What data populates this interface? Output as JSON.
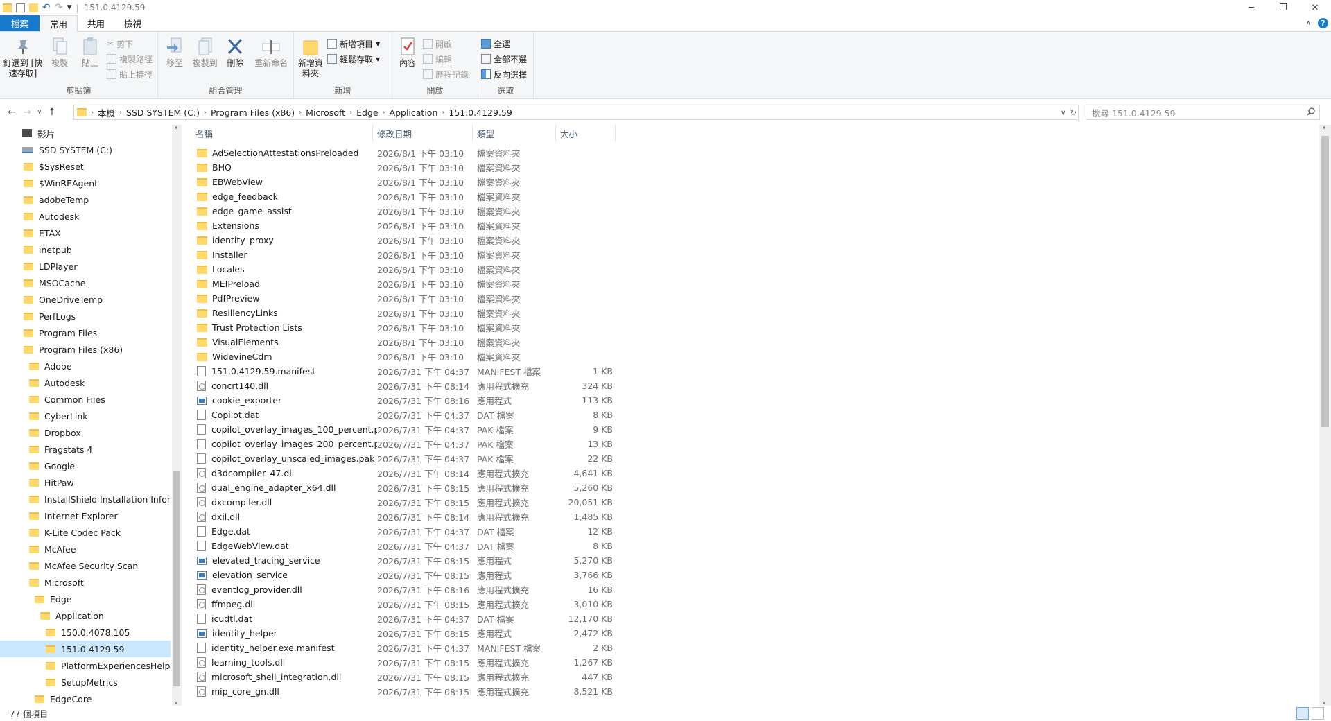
{
  "window": {
    "title": "151.0.4129.59"
  },
  "tabs": [
    {
      "label": "檔案"
    },
    {
      "label": "常用"
    },
    {
      "label": "共用"
    },
    {
      "label": "檢視"
    }
  ],
  "ribbon": {
    "clipboard": {
      "pin": "釘選到 [快速存取]",
      "copy": "複製",
      "paste": "貼上",
      "cut": "剪下",
      "copy_path": "複製路徑",
      "paste_shortcut": "貼上捷徑",
      "label": "剪貼簿"
    },
    "organize": {
      "move_to": "移至",
      "copy_to": "複製到",
      "delete": "刪除",
      "rename": "重新命名",
      "label": "組合管理"
    },
    "new": {
      "new_folder": "新增資料夾",
      "new_item": "新增項目",
      "easy_access": "輕鬆存取",
      "label": "新增"
    },
    "open": {
      "properties": "內容",
      "open": "開啟",
      "edit": "編輯",
      "history": "歷程記錄",
      "label": "開啟"
    },
    "select": {
      "select_all": "全選",
      "select_none": "全部不選",
      "invert": "反向選擇",
      "label": "選取"
    }
  },
  "address": {
    "crumbs": [
      "本機",
      "SSD SYSTEM (C:)",
      "Program Files (x86)",
      "Microsoft",
      "Edge",
      "Application",
      "151.0.4129.59"
    ],
    "search_placeholder": "搜尋 151.0.4129.59"
  },
  "nav": [
    {
      "label": "影片",
      "indent": 0
    },
    {
      "label": "SSD SYSTEM (C:)",
      "indent": 0
    },
    {
      "label": "$SysReset",
      "indent": 1
    },
    {
      "label": "$WinREAgent",
      "indent": 1
    },
    {
      "label": "adobeTemp",
      "indent": 1
    },
    {
      "label": "Autodesk",
      "indent": 1
    },
    {
      "label": "ETAX",
      "indent": 1
    },
    {
      "label": "inetpub",
      "indent": 1
    },
    {
      "label": "LDPlayer",
      "indent": 1
    },
    {
      "label": "MSOCache",
      "indent": 1
    },
    {
      "label": "OneDriveTemp",
      "indent": 1
    },
    {
      "label": "PerfLogs",
      "indent": 1
    },
    {
      "label": "Program Files",
      "indent": 1
    },
    {
      "label": "Program Files (x86)",
      "indent": 1
    },
    {
      "label": "Adobe",
      "indent": 2
    },
    {
      "label": "Autodesk",
      "indent": 2
    },
    {
      "label": "Common Files",
      "indent": 2
    },
    {
      "label": "CyberLink",
      "indent": 2
    },
    {
      "label": "Dropbox",
      "indent": 2
    },
    {
      "label": "Fragstats 4",
      "indent": 2
    },
    {
      "label": "Google",
      "indent": 2
    },
    {
      "label": "HitPaw",
      "indent": 2
    },
    {
      "label": "InstallShield Installation Informa",
      "indent": 2
    },
    {
      "label": "Internet Explorer",
      "indent": 2
    },
    {
      "label": "K-Lite Codec Pack",
      "indent": 2
    },
    {
      "label": "McAfee",
      "indent": 2
    },
    {
      "label": "McAfee Security Scan",
      "indent": 2
    },
    {
      "label": "Microsoft",
      "indent": 2
    },
    {
      "label": "Edge",
      "indent": 3
    },
    {
      "label": "Application",
      "indent": 4
    },
    {
      "label": "150.0.4078.105",
      "indent": 5
    },
    {
      "label": "151.0.4129.59",
      "indent": 5,
      "selected": true
    },
    {
      "label": "PlatformExperiencesHelper",
      "indent": 5
    },
    {
      "label": "SetupMetrics",
      "indent": 5
    },
    {
      "label": "EdgeCore",
      "indent": 3
    }
  ],
  "columns": {
    "name": "名稱",
    "date": "修改日期",
    "type": "類型",
    "size": "大小"
  },
  "files": [
    {
      "name": "AdSelectionAttestationsPreloaded",
      "date": "2026/8/1 下午 03:10",
      "type": "檔案資料夾",
      "size": "",
      "icon": "folder"
    },
    {
      "name": "BHO",
      "date": "2026/8/1 下午 03:10",
      "type": "檔案資料夾",
      "size": "",
      "icon": "folder"
    },
    {
      "name": "EBWebView",
      "date": "2026/8/1 下午 03:10",
      "type": "檔案資料夾",
      "size": "",
      "icon": "folder"
    },
    {
      "name": "edge_feedback",
      "date": "2026/8/1 下午 03:10",
      "type": "檔案資料夾",
      "size": "",
      "icon": "folder"
    },
    {
      "name": "edge_game_assist",
      "date": "2026/8/1 下午 03:10",
      "type": "檔案資料夾",
      "size": "",
      "icon": "folder"
    },
    {
      "name": "Extensions",
      "date": "2026/8/1 下午 03:10",
      "type": "檔案資料夾",
      "size": "",
      "icon": "folder"
    },
    {
      "name": "identity_proxy",
      "date": "2026/8/1 下午 03:10",
      "type": "檔案資料夾",
      "size": "",
      "icon": "folder"
    },
    {
      "name": "Installer",
      "date": "2026/8/1 下午 03:10",
      "type": "檔案資料夾",
      "size": "",
      "icon": "folder"
    },
    {
      "name": "Locales",
      "date": "2026/8/1 下午 03:10",
      "type": "檔案資料夾",
      "size": "",
      "icon": "folder"
    },
    {
      "name": "MEIPreload",
      "date": "2026/8/1 下午 03:10",
      "type": "檔案資料夾",
      "size": "",
      "icon": "folder"
    },
    {
      "name": "PdfPreview",
      "date": "2026/8/1 下午 03:10",
      "type": "檔案資料夾",
      "size": "",
      "icon": "folder"
    },
    {
      "name": "ResiliencyLinks",
      "date": "2026/8/1 下午 03:10",
      "type": "檔案資料夾",
      "size": "",
      "icon": "folder"
    },
    {
      "name": "Trust Protection Lists",
      "date": "2026/8/1 下午 03:10",
      "type": "檔案資料夾",
      "size": "",
      "icon": "folder"
    },
    {
      "name": "VisualElements",
      "date": "2026/8/1 下午 03:10",
      "type": "檔案資料夾",
      "size": "",
      "icon": "folder"
    },
    {
      "name": "WidevineCdm",
      "date": "2026/8/1 下午 03:10",
      "type": "檔案資料夾",
      "size": "",
      "icon": "folder"
    },
    {
      "name": "151.0.4129.59.manifest",
      "date": "2026/7/31 下午 04:37",
      "type": "MANIFEST 檔案",
      "size": "1 KB",
      "icon": "doc"
    },
    {
      "name": "concrt140.dll",
      "date": "2026/7/31 下午 08:14",
      "type": "應用程式擴充",
      "size": "324 KB",
      "icon": "dll"
    },
    {
      "name": "cookie_exporter",
      "date": "2026/7/31 下午 08:16",
      "type": "應用程式",
      "size": "113 KB",
      "icon": "exe"
    },
    {
      "name": "Copilot.dat",
      "date": "2026/7/31 下午 04:37",
      "type": "DAT 檔案",
      "size": "8 KB",
      "icon": "doc"
    },
    {
      "name": "copilot_overlay_images_100_percent.p...",
      "date": "2026/7/31 下午 04:37",
      "type": "PAK 檔案",
      "size": "9 KB",
      "icon": "doc"
    },
    {
      "name": "copilot_overlay_images_200_percent.p...",
      "date": "2026/7/31 下午 04:37",
      "type": "PAK 檔案",
      "size": "13 KB",
      "icon": "doc"
    },
    {
      "name": "copilot_overlay_unscaled_images.pak",
      "date": "2026/7/31 下午 04:37",
      "type": "PAK 檔案",
      "size": "22 KB",
      "icon": "doc"
    },
    {
      "name": "d3dcompiler_47.dll",
      "date": "2026/7/31 下午 08:14",
      "type": "應用程式擴充",
      "size": "4,641 KB",
      "icon": "dll"
    },
    {
      "name": "dual_engine_adapter_x64.dll",
      "date": "2026/7/31 下午 08:15",
      "type": "應用程式擴充",
      "size": "5,260 KB",
      "icon": "dll"
    },
    {
      "name": "dxcompiler.dll",
      "date": "2026/7/31 下午 08:15",
      "type": "應用程式擴充",
      "size": "20,051 KB",
      "icon": "dll"
    },
    {
      "name": "dxil.dll",
      "date": "2026/7/31 下午 08:14",
      "type": "應用程式擴充",
      "size": "1,485 KB",
      "icon": "dll"
    },
    {
      "name": "Edge.dat",
      "date": "2026/7/31 下午 04:37",
      "type": "DAT 檔案",
      "size": "12 KB",
      "icon": "doc"
    },
    {
      "name": "EdgeWebView.dat",
      "date": "2026/7/31 下午 04:37",
      "type": "DAT 檔案",
      "size": "8 KB",
      "icon": "doc"
    },
    {
      "name": "elevated_tracing_service",
      "date": "2026/7/31 下午 08:15",
      "type": "應用程式",
      "size": "5,270 KB",
      "icon": "exe"
    },
    {
      "name": "elevation_service",
      "date": "2026/7/31 下午 08:15",
      "type": "應用程式",
      "size": "3,766 KB",
      "icon": "exe"
    },
    {
      "name": "eventlog_provider.dll",
      "date": "2026/7/31 下午 08:16",
      "type": "應用程式擴充",
      "size": "16 KB",
      "icon": "dll"
    },
    {
      "name": "ffmpeg.dll",
      "date": "2026/7/31 下午 08:15",
      "type": "應用程式擴充",
      "size": "3,010 KB",
      "icon": "dll"
    },
    {
      "name": "icudtl.dat",
      "date": "2026/7/31 下午 04:37",
      "type": "DAT 檔案",
      "size": "12,170 KB",
      "icon": "doc"
    },
    {
      "name": "identity_helper",
      "date": "2026/7/31 下午 08:15",
      "type": "應用程式",
      "size": "2,472 KB",
      "icon": "exe"
    },
    {
      "name": "identity_helper.exe.manifest",
      "date": "2026/7/31 下午 04:37",
      "type": "MANIFEST 檔案",
      "size": "2 KB",
      "icon": "doc"
    },
    {
      "name": "learning_tools.dll",
      "date": "2026/7/31 下午 08:15",
      "type": "應用程式擴充",
      "size": "1,267 KB",
      "icon": "dll"
    },
    {
      "name": "microsoft_shell_integration.dll",
      "date": "2026/7/31 下午 08:15",
      "type": "應用程式擴充",
      "size": "447 KB",
      "icon": "dll"
    },
    {
      "name": "mip_core_gn.dll",
      "date": "2026/7/31 下午 08:15",
      "type": "應用程式擴充",
      "size": "8,521 KB",
      "icon": "dll"
    }
  ],
  "status": {
    "count": "77 個項目"
  }
}
